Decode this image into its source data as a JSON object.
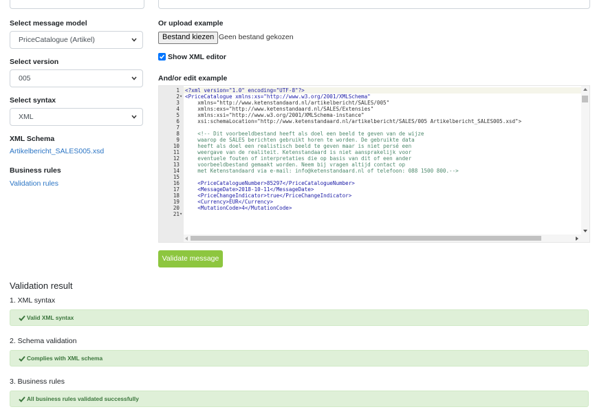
{
  "sidebar": {
    "message_model": {
      "label": "Select message model",
      "value": "PriceCatalogue (Artikel)"
    },
    "version": {
      "label": "Select version",
      "value": "005"
    },
    "syntax": {
      "label": "Select syntax",
      "value": "XML"
    },
    "xml_schema": {
      "label": "XML Schema",
      "link": "Artikelbericht_SALES005.xsd"
    },
    "business_rules": {
      "label": "Business rules",
      "link": "Validation rules"
    }
  },
  "upload": {
    "label": "Or upload example",
    "button": "Bestand kiezen",
    "status": "Geen bestand gekozen"
  },
  "xml_editor_toggle": {
    "label": "Show XML editor",
    "checked": true
  },
  "editor": {
    "label": "And/or edit example",
    "lines": [
      {
        "n": "1",
        "fold": "",
        "text": "<?xml version=\"1.0\" encoding=\"UTF-8\"?>"
      },
      {
        "n": "2",
        "fold": "▾",
        "text": "<PriceCatalogue xmlns:xs=\"http://www.w3.org/2001/XMLSchema\""
      },
      {
        "n": "3",
        "fold": "",
        "text": "    xmlns=\"http://www.ketenstandaard.nl/artikelbericht/SALES/005\""
      },
      {
        "n": "4",
        "fold": "",
        "text": "    xmlns:exs=\"http://www.ketenstandaard.nl/SALES/Extensies\""
      },
      {
        "n": "5",
        "fold": "",
        "text": "    xmlns:xsi=\"http://www.w3.org/2001/XMLSchema-instance\""
      },
      {
        "n": "6",
        "fold": "",
        "text": "    xsi:schemaLocation=\"http://www.ketenstandaard.nl/artikelbericht/SALES/005 Artikelbericht_SALES005.xsd\">"
      },
      {
        "n": "7",
        "fold": "",
        "text": ""
      },
      {
        "n": "8",
        "fold": "",
        "text": "    <!-- Dit voorbeeldbestand heeft als doel een beeld te geven van de wijze"
      },
      {
        "n": "9",
        "fold": "",
        "text": "    waarop de SALES berichten gebruikt horen te worden. De gebruikte data"
      },
      {
        "n": "10",
        "fold": "",
        "text": "    heeft als doel een realistisch beeld te geven maar is niet persé een"
      },
      {
        "n": "11",
        "fold": "",
        "text": "    weergave van de realiteit. Ketenstandaard is niet aansprakelijk voor"
      },
      {
        "n": "12",
        "fold": "",
        "text": "    eventuele fouten of interpretaties die op basis van dit of een ander"
      },
      {
        "n": "13",
        "fold": "",
        "text": "    voorbeeldbestand gemaakt worden. Neem bij vragen altijd contact op"
      },
      {
        "n": "14",
        "fold": "",
        "text": "    met Ketenstandaard via e-mail: info@ketenstandaard.nl of telefoon: 088 1500 800.-->"
      },
      {
        "n": "15",
        "fold": "",
        "text": ""
      },
      {
        "n": "16",
        "fold": "",
        "text": "    <PriceCatalogueNumber>85297</PriceCatalogueNumber>"
      },
      {
        "n": "17",
        "fold": "",
        "text": "    <MessageDate>2018-10-11</MessageDate>"
      },
      {
        "n": "18",
        "fold": "",
        "text": "    <PriceChangeIndicator>true</PriceChangeIndicator>"
      },
      {
        "n": "19",
        "fold": "",
        "text": "    <Currency>EUR</Currency>"
      },
      {
        "n": "20",
        "fold": "",
        "text": "    <MutationCode>4</MutationCode>"
      },
      {
        "n": "21",
        "fold": "▾",
        "text": ""
      }
    ]
  },
  "validate_button": "Validate message",
  "results": {
    "title": "Validation result",
    "steps": [
      {
        "label": "1. XML syntax",
        "message": "Valid XML syntax"
      },
      {
        "label": "2. Schema validation",
        "message": "Complies with XML schema"
      },
      {
        "label": "3. Business rules",
        "message": "All business rules validated successfully"
      }
    ]
  },
  "colors": {
    "accent": "#8dc63f",
    "link": "#2a74c4",
    "success_bg": "#dff0d8",
    "success_text": "#3c763d",
    "checkbox": "#0075ff"
  }
}
